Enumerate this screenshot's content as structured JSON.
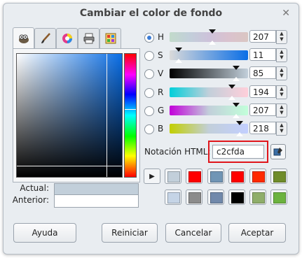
{
  "window": {
    "title": "Cambiar el color de fondo"
  },
  "icons": {
    "close": "close-icon",
    "tabs": [
      "wilber-icon",
      "brush-icon",
      "color-wheel-icon",
      "printer-icon",
      "palette-icon"
    ]
  },
  "channels": [
    {
      "key": "h",
      "label": "H",
      "value": "207",
      "selected": true
    },
    {
      "key": "s",
      "label": "S",
      "value": "11",
      "selected": false
    },
    {
      "key": "v",
      "label": "V",
      "value": "85",
      "selected": false
    },
    {
      "key": "r",
      "label": "R",
      "value": "194",
      "selected": false
    },
    {
      "key": "g",
      "label": "G",
      "value": "207",
      "selected": false
    },
    {
      "key": "b",
      "label": "B",
      "value": "218",
      "selected": false
    }
  ],
  "swatches": {
    "current_label": "Actual:",
    "previous_label": "Anterior:",
    "current_color": "#c2cfda",
    "previous_color": "#ffffff"
  },
  "html_notation": {
    "label": "Notación HTML:",
    "value": "c2cfda"
  },
  "history": {
    "row1": [
      "#c2cfda",
      "#ff0000",
      "#7095b5",
      "#ff0000",
      "#ff2a00",
      "#6f8c2a"
    ],
    "row2": [
      "#c5d4e6",
      "#8c8c8c",
      "#7189ab",
      "#000000",
      "#8fae6a",
      "#6cb33f"
    ]
  },
  "buttons": {
    "help": "Ayuda",
    "reset": "Reiniciar",
    "cancel": "Cancelar",
    "accept": "Aceptar"
  }
}
